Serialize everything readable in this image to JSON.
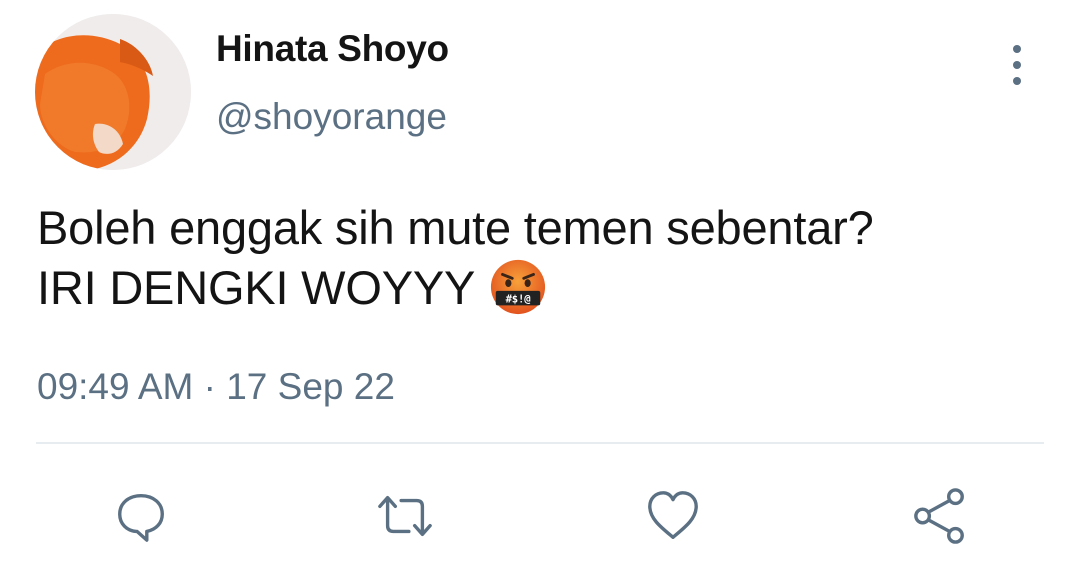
{
  "user": {
    "display_name": "Hinata Shoyo",
    "handle": "@shoyorange"
  },
  "tweet": {
    "line1": "Boleh enggak sih mute temen sebentar?",
    "line2": "IRI DENGKI WOYYY",
    "emoji": "face-with-symbols-on-mouth",
    "emoji_text": "#$!@",
    "timestamp": "09:49 AM · 17 Sep 22"
  },
  "actions": [
    {
      "icon": "reply-icon"
    },
    {
      "icon": "retweet-icon"
    },
    {
      "icon": "like-icon"
    },
    {
      "icon": "share-icon"
    }
  ],
  "colors": {
    "primary_text": "#141414",
    "secondary_text": "#5b7083",
    "divider": "#e6ecf0",
    "avatar_hair": "#ef6a1a"
  }
}
